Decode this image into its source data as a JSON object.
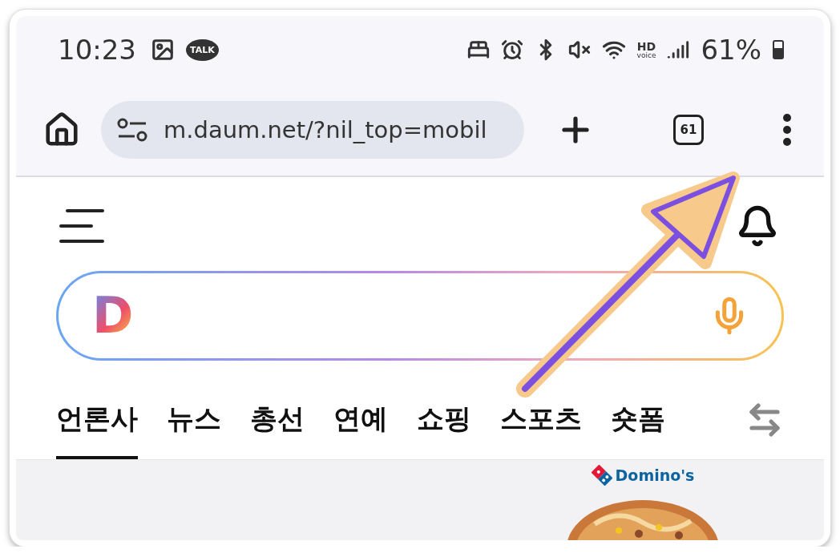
{
  "status_bar": {
    "time": "10:23",
    "talk_badge": "TALK",
    "hd_badge": "HD",
    "voice_badge": "voice",
    "battery": "61%"
  },
  "browser": {
    "url": "m.daum.net/?nil_top=mobil",
    "tab_count": "61"
  },
  "search": {
    "logo": "D"
  },
  "tabs": [
    {
      "label": "언론사",
      "selected": true
    },
    {
      "label": "뉴스",
      "selected": false
    },
    {
      "label": "총선",
      "selected": false
    },
    {
      "label": "연예",
      "selected": false
    },
    {
      "label": "쇼핑",
      "selected": false
    },
    {
      "label": "스포츠",
      "selected": false
    },
    {
      "label": "숏폼",
      "selected": false
    }
  ],
  "ad": {
    "brand": "Domino's",
    "kind": "picture"
  }
}
